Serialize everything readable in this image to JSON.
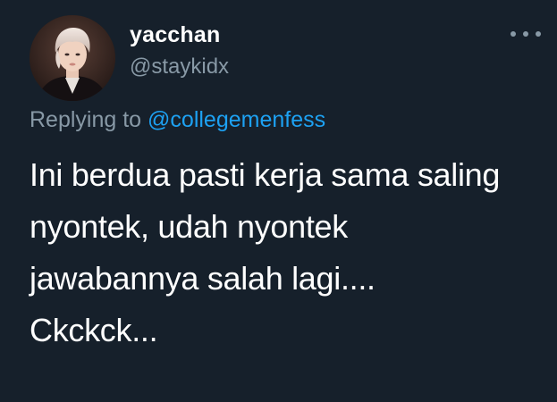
{
  "tweet": {
    "display_name": "yacchan",
    "handle": "@staykidx",
    "replying_prefix": "Replying to",
    "replying_to": "@collegemenfess",
    "text_lines": [
      "Ini berdua pasti kerja sama saling",
      "nyontek, udah nyontek",
      "jawabannya salah lagi....",
      "Ckckck..."
    ]
  },
  "icons": {
    "avatar": "profile-photo",
    "more": "more-horizontal-icon"
  },
  "colors": {
    "background": "#16202b",
    "primary_text": "#ffffff",
    "secondary_text": "#8899a6",
    "link": "#1da1f2"
  }
}
